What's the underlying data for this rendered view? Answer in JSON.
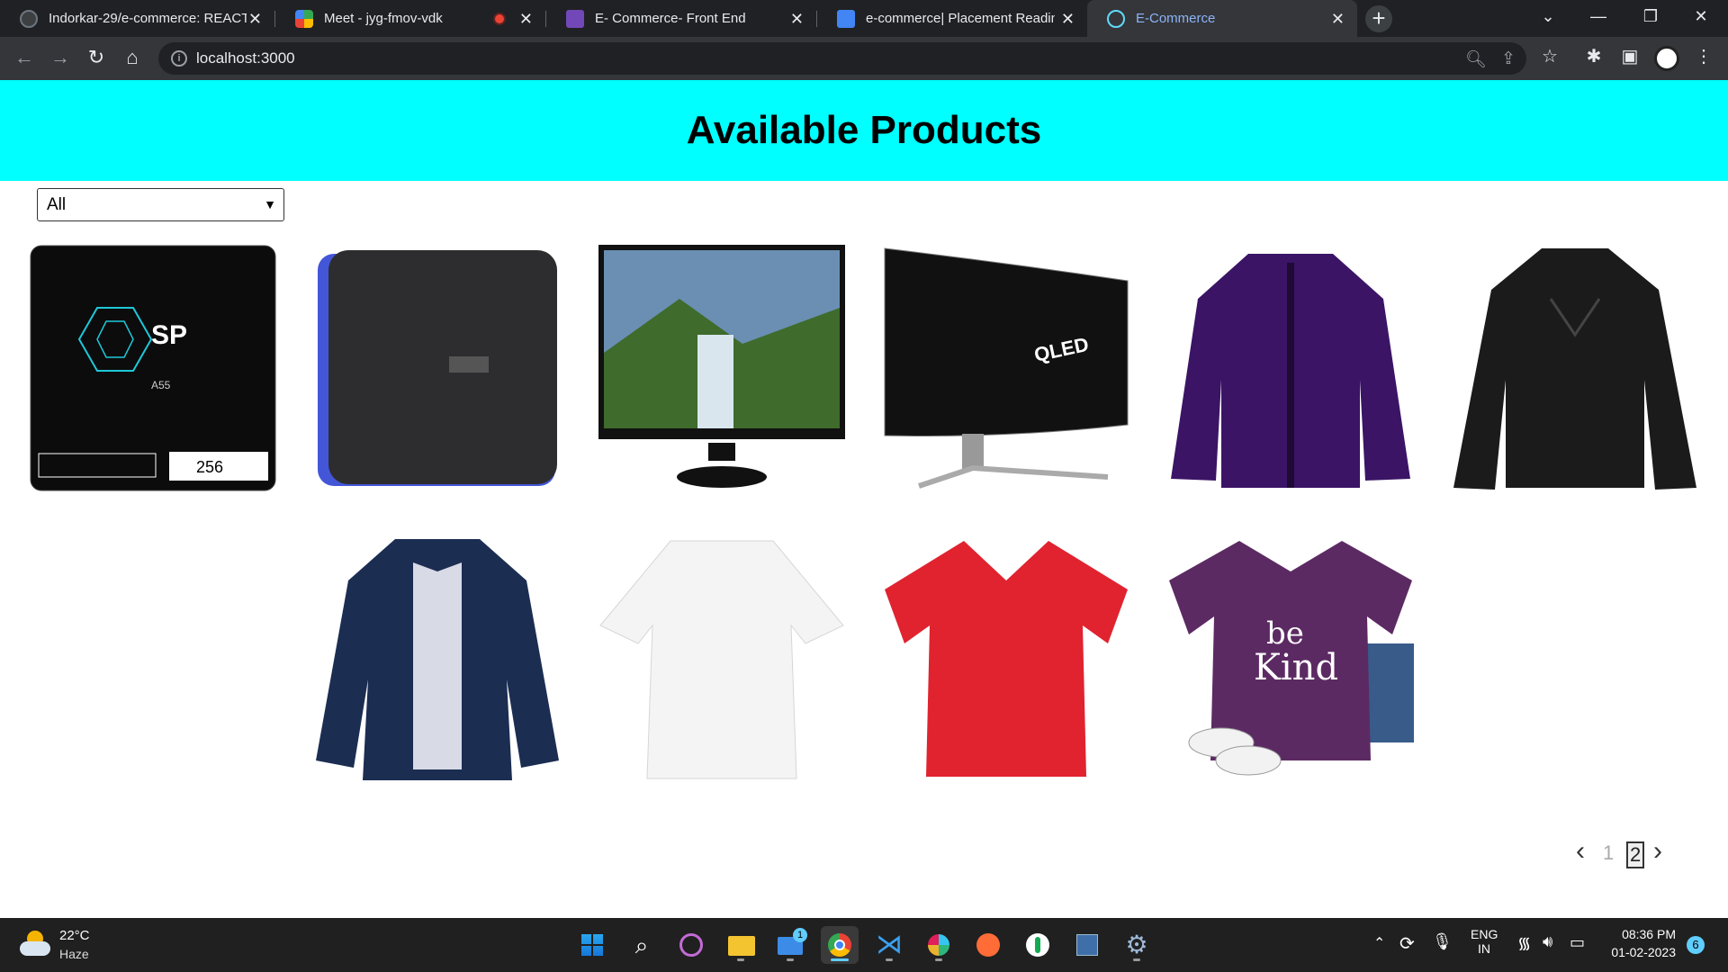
{
  "browser": {
    "tabs": [
      {
        "title": "Indorkar-29/e-commerce: REACT",
        "favicon": "github-icon",
        "active": false
      },
      {
        "title": "Meet - jyg-fmov-vdk",
        "favicon": "google-meet-icon",
        "active": false,
        "recording": true
      },
      {
        "title": "E- Commerce- Front End",
        "favicon": "forms-icon",
        "active": false
      },
      {
        "title": "e-commerce| Placement Reading",
        "favicon": "google-docs-icon",
        "active": false
      },
      {
        "title": "E-Commerce",
        "favicon": "react-icon",
        "active": true
      }
    ],
    "url": "localhost:3000"
  },
  "page": {
    "title": "Available Products",
    "header_color": "#00ffff",
    "filter": {
      "selected": "All"
    },
    "products": [
      {
        "name": "Silicon Power A55 SSD 256GB",
        "icon": "ssd-image"
      },
      {
        "name": "WD external hard drive",
        "icon": "hdd-image"
      },
      {
        "name": "Acer monitor",
        "icon": "monitor-image"
      },
      {
        "name": "Samsung QLED gaming monitor",
        "icon": "curved-monitor-image"
      },
      {
        "name": "Purple jacket",
        "icon": "purple-jacket-image"
      },
      {
        "name": "Black leather jacket",
        "icon": "leather-jacket-image"
      },
      {
        "name": "Navy jacket",
        "icon": "navy-jacket-image"
      },
      {
        "name": "White top",
        "icon": "white-top-image"
      },
      {
        "name": "Red t-shirt",
        "icon": "red-tshirt-image"
      },
      {
        "name": "Purple be kind t-shirt",
        "icon": "purple-tshirt-image"
      }
    ],
    "pagination": {
      "prev": "‹",
      "pages": [
        "1",
        "2"
      ],
      "current": "2",
      "next": "›"
    }
  },
  "taskbar": {
    "weather": {
      "temp": "22°C",
      "condition": "Haze"
    },
    "language": {
      "line1": "ENG",
      "line2": "IN"
    },
    "time": "08:36 PM",
    "date": "01-02-2023",
    "notifications": "6",
    "mail_badge": "1"
  }
}
